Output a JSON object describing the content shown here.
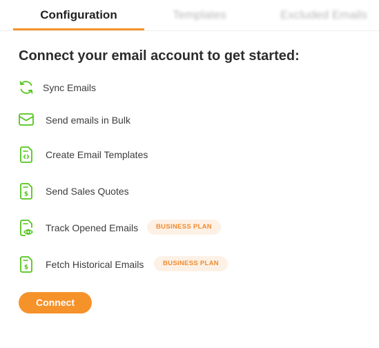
{
  "tabs": [
    {
      "label": "Configuration",
      "active": true
    },
    {
      "label": "Templates",
      "active": false
    },
    {
      "label": "Excluded Emails",
      "active": false
    }
  ],
  "heading": "Connect your email account to get started:",
  "features": [
    {
      "label": "Sync Emails",
      "icon": "sync-icon"
    },
    {
      "label": "Send emails in Bulk",
      "icon": "envelope-icon"
    },
    {
      "label": "Create Email Templates",
      "icon": "template-document-icon"
    },
    {
      "label": "Send Sales Quotes",
      "icon": "quote-document-icon"
    },
    {
      "label": "Track Opened Emails",
      "icon": "tracked-document-icon",
      "badge": "BUSINESS PLAN"
    },
    {
      "label": "Fetch Historical Emails",
      "icon": "history-document-icon",
      "badge": "BUSINESS PLAN"
    }
  ],
  "connect_button": "Connect",
  "colors": {
    "accent": "#f6922a",
    "icon_green": "#52c41a",
    "badge_bg": "#fdf1e6",
    "badge_text": "#f08a2e"
  }
}
